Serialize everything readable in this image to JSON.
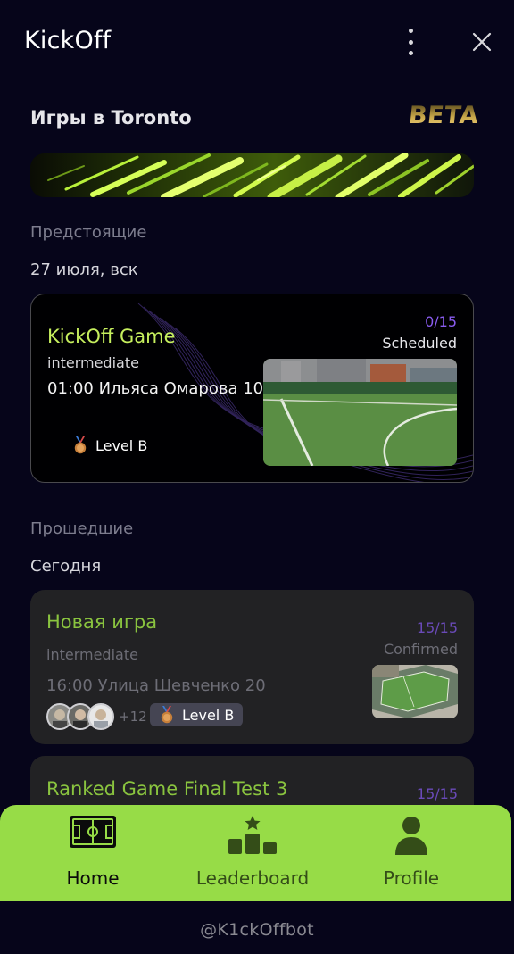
{
  "app": {
    "title": "KickOff"
  },
  "header": {
    "city_title": "Игры в Toronto",
    "beta_label": "BETA"
  },
  "upcoming": {
    "section_label": "Предстоящие",
    "date_label": "27 июля, вск",
    "game": {
      "title": "KickOff Game",
      "level": "intermediate",
      "time_address": "01:00 Ильяса Омарова 10",
      "badge_label": "Level B",
      "counter": "0/15",
      "status": "Scheduled"
    }
  },
  "past": {
    "section_label": "Прошедшие",
    "date_label": "Сегодня",
    "games": [
      {
        "title": "Новая игра",
        "level": "intermediate",
        "time_address": "16:00 Улица Шевченко 20",
        "badge_label": "Level B",
        "counter": "15/15",
        "status": "Confirmed",
        "more_players": "+12"
      },
      {
        "title": "Ranked Game Final Test 3",
        "counter": "15/15"
      }
    ]
  },
  "bottom_nav": {
    "items": [
      {
        "label": "Home",
        "icon": "field-icon",
        "active": true
      },
      {
        "label": "Leaderboard",
        "icon": "podium-icon",
        "active": false
      },
      {
        "label": "Profile",
        "icon": "person-icon",
        "active": false
      }
    ]
  },
  "footer": {
    "handle": "@K1ckOffbot"
  },
  "colors": {
    "background": "#06051a",
    "accent_green": "#97dc47",
    "title_green": "#c6ef5e",
    "past_title_green": "#8ac43f",
    "counter_purple": "#8a5cf0",
    "card_dark": "#222224"
  }
}
